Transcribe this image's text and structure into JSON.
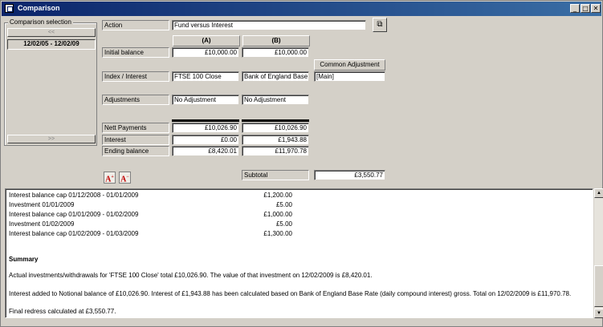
{
  "window": {
    "title": "Comparison",
    "controls": {
      "minimize": "_",
      "maximize": "□",
      "close": "✕"
    }
  },
  "comparison_selection": {
    "label": "Comparison selection",
    "prev_button": "<<",
    "next_button": ">>",
    "items": [
      "12/02/05 - 12/02/09"
    ]
  },
  "form": {
    "action_label": "Action",
    "action_value": "Fund versus Interest",
    "col_a_header": "(A)",
    "col_b_header": "(B)",
    "common_adjustment_header": "Common Adjustment",
    "initial_balance_label": "Initial balance",
    "initial_balance_a": "£10,000.00",
    "initial_balance_b": "£10,000.00",
    "index_label": "Index / Interest",
    "index_a": "FTSE 100 Close",
    "index_b": "Bank of England Base",
    "common_adjustment_value": "[Main]",
    "adjustments_label": "Adjustments",
    "adjustments_a": "No Adjustment",
    "adjustments_b": "No Adjustment",
    "nett_payments_label": "Nett Payments",
    "nett_payments_a": "£10,026.90",
    "nett_payments_b": "£10,026.90",
    "interest_label": "Interest",
    "interest_a": "£0.00",
    "interest_b": "£1,943.88",
    "ending_balance_label": "Ending balance",
    "ending_balance_a": "£8,420.01",
    "ending_balance_b": "£11,970.78",
    "subtotal_label": "Subtotal",
    "subtotal_value": "£3,550.77"
  },
  "font_buttons": {
    "increase": "A",
    "decrease": "A"
  },
  "report": {
    "ledger": [
      {
        "text": "Interest balance cap 01/12/2008 - 01/01/2009",
        "amount": "£1,200.00"
      },
      {
        "text": "Investment 01/01/2009",
        "amount": "£5.00"
      },
      {
        "text": "Interest balance cap 01/01/2009 - 01/02/2009",
        "amount": "£1,000.00"
      },
      {
        "text": "Investment 01/02/2009",
        "amount": "£5.00"
      },
      {
        "text": "Interest balance cap 01/02/2009 - 01/03/2009",
        "amount": "£1,300.00"
      }
    ],
    "summary_heading": "Summary",
    "summary_line1": "Actual investments/withdrawals for 'FTSE 100 Close' total £10,026.90. The value of that investment on 12/02/2009 is £8,420.01.",
    "summary_line2": "Interest added to Notional balance of £10,026.90. Interest of £1,943.88 has been calculated based on Bank of England Base Rate (daily compound interest) gross. Total on 12/02/2009 is £11,970.78.",
    "summary_line3": "Final redress calculated at £3,550.77."
  }
}
